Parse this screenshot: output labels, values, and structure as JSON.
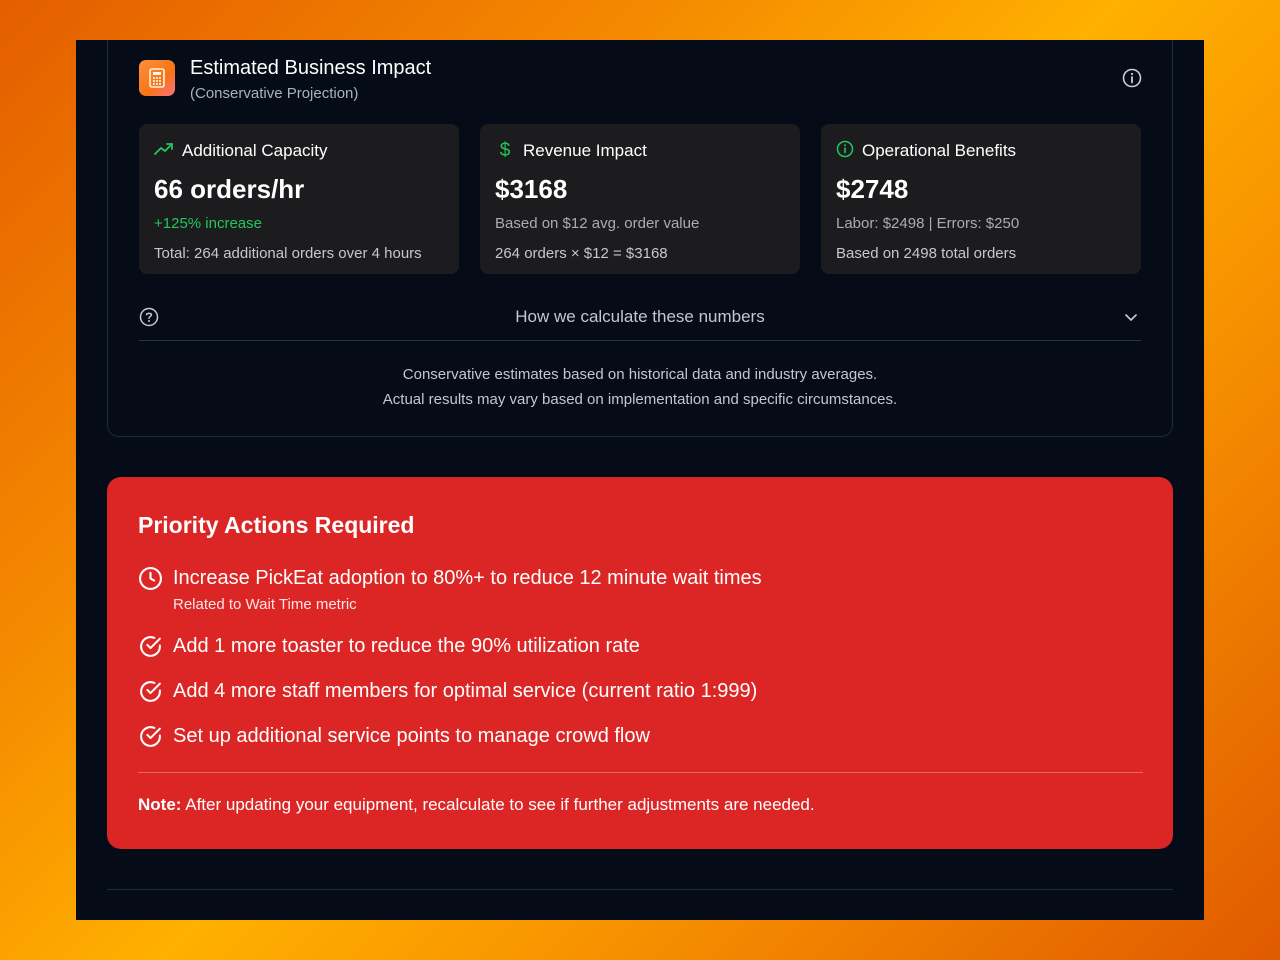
{
  "header": {
    "title": "Estimated Business Impact",
    "subtitle": "(Conservative Projection)",
    "icon": "calculator-icon"
  },
  "metrics": [
    {
      "icon": "trending-up-icon",
      "title": "Additional Capacity",
      "value": "66 orders/hr",
      "line1": "+125% increase",
      "line2": "Total: 264 additional orders over 4 hours"
    },
    {
      "icon": "dollar-icon",
      "title": "Revenue Impact",
      "value": "$3168",
      "line1": "Based on $12 avg. order value",
      "line2": "264 orders × $12 = $3168"
    },
    {
      "icon": "info-circle-icon",
      "title": "Operational Benefits",
      "value": "$2748",
      "line1": "Labor: $2498 | Errors: $250",
      "line2": "Based on 2498 total orders"
    }
  ],
  "calculation": {
    "label": "How we calculate these numbers",
    "disclaimer_line1": "Conservative estimates based on historical data and industry averages.",
    "disclaimer_line2": "Actual results may vary based on implementation and specific circumstances."
  },
  "priority": {
    "title": "Priority Actions Required",
    "items": [
      {
        "icon": "clock-icon",
        "text": "Increase PickEat adoption to 80%+ to reduce 12 minute wait times",
        "sub": "Related to Wait Time metric"
      },
      {
        "icon": "check-circle-icon",
        "text": "Add 1 more toaster to reduce the 90% utilization rate"
      },
      {
        "icon": "check-circle-icon",
        "text": "Add 4 more staff members for optimal service (current ratio 1:999)"
      },
      {
        "icon": "check-circle-icon",
        "text": "Set up additional service points to manage crowd flow"
      }
    ],
    "note_label": "Note:",
    "note_text": " After updating your equipment, recalculate to see if further adjustments are needed."
  },
  "colors": {
    "background": "#050b17",
    "card": "#1c1c1e",
    "accent_green": "#22c55e",
    "alert_red": "#dc2626",
    "icon_orange": "#f97316"
  }
}
